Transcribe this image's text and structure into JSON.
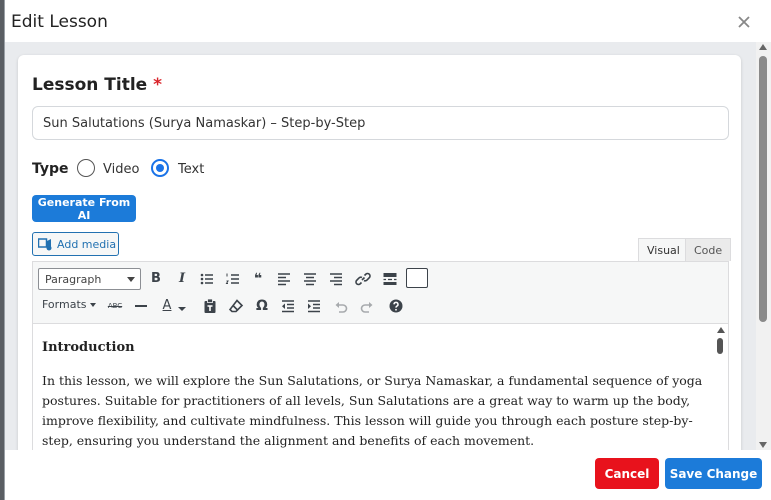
{
  "modal": {
    "title": "Edit Lesson",
    "close_icon": "close-icon"
  },
  "form": {
    "lesson_title_label": "Lesson Title",
    "required_mark": "*",
    "lesson_title_value": "Sun Salutations (Surya Namaskar) – Step-by-Step",
    "type_label": "Type",
    "type_options": [
      {
        "label": "Video",
        "checked": false
      },
      {
        "label": "Text",
        "checked": true
      }
    ],
    "generate_ai_label": "Generate From AI",
    "add_media_label": "Add media"
  },
  "editor": {
    "tabs": [
      {
        "label": "Visual",
        "active": true
      },
      {
        "label": "Code",
        "active": false
      }
    ],
    "paragraph_select": "Paragraph",
    "formats_label": "Formats",
    "toolbar_row1_icons": [
      "bold-icon",
      "italic-icon",
      "bullet-list-icon",
      "numbered-list-icon",
      "blockquote-icon",
      "align-left-icon",
      "align-center-icon",
      "align-right-icon",
      "link-icon",
      "read-more-icon",
      "toolbar-toggle-icon"
    ],
    "toolbar_row2_icons": [
      "strikethrough-icon",
      "horizontal-line-icon",
      "text-color-icon",
      "paste-text-icon",
      "clear-formatting-icon",
      "special-character-icon",
      "outdent-icon",
      "indent-icon",
      "undo-icon",
      "redo-icon",
      "help-icon"
    ],
    "bold_glyph": "B",
    "italic_glyph": "I",
    "strike_glyph": "ABC",
    "color_glyph": "A",
    "omega_glyph": "Ω",
    "quote_glyph": "❝",
    "content_heading": "Introduction",
    "content_paragraph": "In this lesson, we will explore the Sun Salutations, or Surya Namaskar, a fundamental sequence of yoga postures. Suitable for practitioners of all levels, Sun Salutations are a great way to warm up the body, improve flexibility, and cultivate mindfulness. This lesson will guide you through each posture step-by-step, ensuring you understand the alignment and benefits of each movement."
  },
  "footer": {
    "cancel_label": "Cancel",
    "save_label": "Save Change"
  },
  "colors": {
    "primary": "#1c7bd9",
    "danger": "#e8121c",
    "required": "#d9252b"
  }
}
